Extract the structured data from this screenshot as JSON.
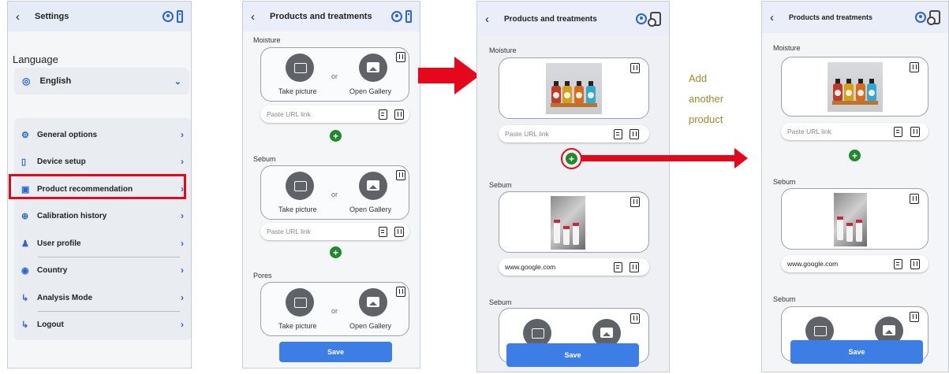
{
  "settings": {
    "title": "Settings",
    "language_heading": "Language",
    "language_value": "English",
    "menu": [
      {
        "label": "General options",
        "icon": "gear-icon"
      },
      {
        "label": "Device setup",
        "icon": "device-icon"
      },
      {
        "label": "Product recommendation",
        "icon": "product-icon"
      },
      {
        "label": "Calibration history",
        "icon": "crosshair-icon"
      },
      {
        "label": "User profile",
        "icon": "user-icon"
      },
      {
        "label": "Country",
        "icon": "globe-icon"
      },
      {
        "label": "Analysis Mode",
        "icon": "login-icon"
      },
      {
        "label": "Logout",
        "icon": "logout-icon"
      }
    ]
  },
  "products": {
    "title": "Products and treatments",
    "take_picture": "Take picture",
    "or": "or",
    "open_gallery": "Open Gallery",
    "url_placeholder": "Paste URL link",
    "url_filled": "www.google.com",
    "sections": [
      "Moisture",
      "Sebum",
      "Pores"
    ],
    "save": "Save"
  },
  "annotation": {
    "line1": "Add",
    "line2": "another",
    "line3": "product"
  },
  "colors": {
    "accent_blue": "#3d7ee6",
    "highlight_red": "#e5081c",
    "add_green": "#1f8a2a"
  }
}
